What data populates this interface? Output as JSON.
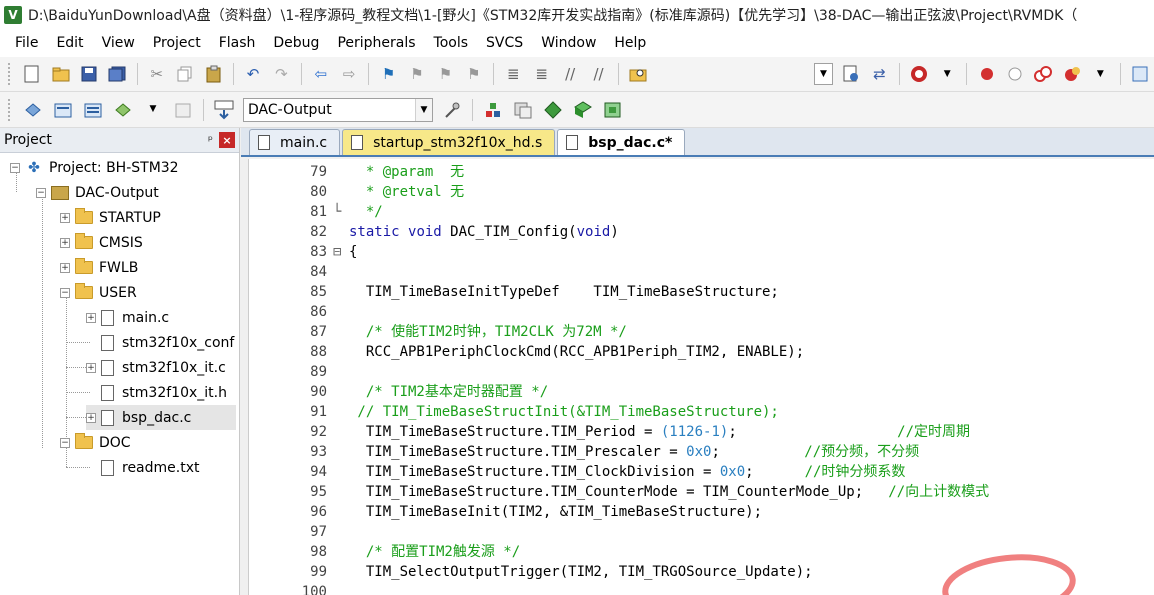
{
  "window": {
    "title": "D:\\BaiduYunDownload\\A盘（资料盘）\\1-程序源码_教程文档\\1-[野火]《STM32库开发实战指南》(标准库源码)【优先学习】\\38-DAC—输出正弦波\\Project\\RVMDK（"
  },
  "menu": [
    "File",
    "Edit",
    "View",
    "Project",
    "Flash",
    "Debug",
    "Peripherals",
    "Tools",
    "SVCS",
    "Window",
    "Help"
  ],
  "toolbar2": {
    "target_value": "DAC-Output"
  },
  "project_panel": {
    "title": "Project",
    "pin_glyph": "ᵖ",
    "close_glyph": "×",
    "expander_minus": "−",
    "expander_plus": "+",
    "tree": {
      "project": "Project: BH-STM32",
      "target": "DAC-Output",
      "groups": {
        "startup": "STARTUP",
        "cmsis": "CMSIS",
        "fwlb": "FWLB",
        "user": "USER",
        "doc": "DOC"
      },
      "user_files": [
        "main.c",
        "stm32f10x_conf",
        "stm32f10x_it.c",
        "stm32f10x_it.h",
        "bsp_dac.c"
      ],
      "doc_files": [
        "readme.txt"
      ]
    }
  },
  "tabs": [
    "main.c",
    "startup_stm32f10x_hd.s",
    "bsp_dac.c*"
  ],
  "editor": {
    "lines": [
      {
        "n": "79",
        "fold": "",
        "code": "  * @param  无"
      },
      {
        "n": "80",
        "fold": "",
        "code": "  * @retval 无"
      },
      {
        "n": "81",
        "fold": "└",
        "code": "  */"
      },
      {
        "n": "82",
        "fold": "",
        "code": "static void DAC_TIM_Config(void)"
      },
      {
        "n": "83",
        "fold": "⊟",
        "code": "{"
      },
      {
        "n": "84",
        "fold": "",
        "code": ""
      },
      {
        "n": "85",
        "fold": "",
        "code": "  TIM_TimeBaseInitTypeDef    TIM_TimeBaseStructure;"
      },
      {
        "n": "86",
        "fold": "",
        "code": ""
      },
      {
        "n": "87",
        "fold": "",
        "code": "  /* 使能TIM2时钟，TIM2CLK 为72M */"
      },
      {
        "n": "88",
        "fold": "",
        "code": "  RCC_APB1PeriphClockCmd(RCC_APB1Periph_TIM2, ENABLE);"
      },
      {
        "n": "89",
        "fold": "",
        "code": ""
      },
      {
        "n": "90",
        "fold": "",
        "code": "  /* TIM2基本定时器配置 */"
      },
      {
        "n": "91",
        "fold": "",
        "code": " // TIM_TimeBaseStructInit(&TIM_TimeBaseStructure);"
      },
      {
        "n": "92",
        "fold": "",
        "code": "  TIM_TimeBaseStructure.TIM_Period = (1126-1);",
        "comment": "                   //定时周期"
      },
      {
        "n": "93",
        "fold": "",
        "code": "  TIM_TimeBaseStructure.TIM_Prescaler = 0x0;",
        "comment": "          //预分频，不分频"
      },
      {
        "n": "94",
        "fold": "",
        "code": "  TIM_TimeBaseStructure.TIM_ClockDivision = 0x0;",
        "comment": "      //时钟分频系数"
      },
      {
        "n": "95",
        "fold": "",
        "code": "  TIM_TimeBaseStructure.TIM_CounterMode = TIM_CounterMode_Up;",
        "comment": "   //向上计数模式"
      },
      {
        "n": "96",
        "fold": "",
        "code": "  TIM_TimeBaseInit(TIM2, &TIM_TimeBaseStructure);"
      },
      {
        "n": "97",
        "fold": "",
        "code": ""
      },
      {
        "n": "98",
        "fold": "",
        "code": "  /* 配置TIM2触发源 */"
      },
      {
        "n": "99",
        "fold": "",
        "code": "  TIM_SelectOutputTrigger(TIM2, TIM_TRGOSource_Update);"
      },
      {
        "n": "100",
        "fold": "",
        "code": ""
      }
    ]
  }
}
